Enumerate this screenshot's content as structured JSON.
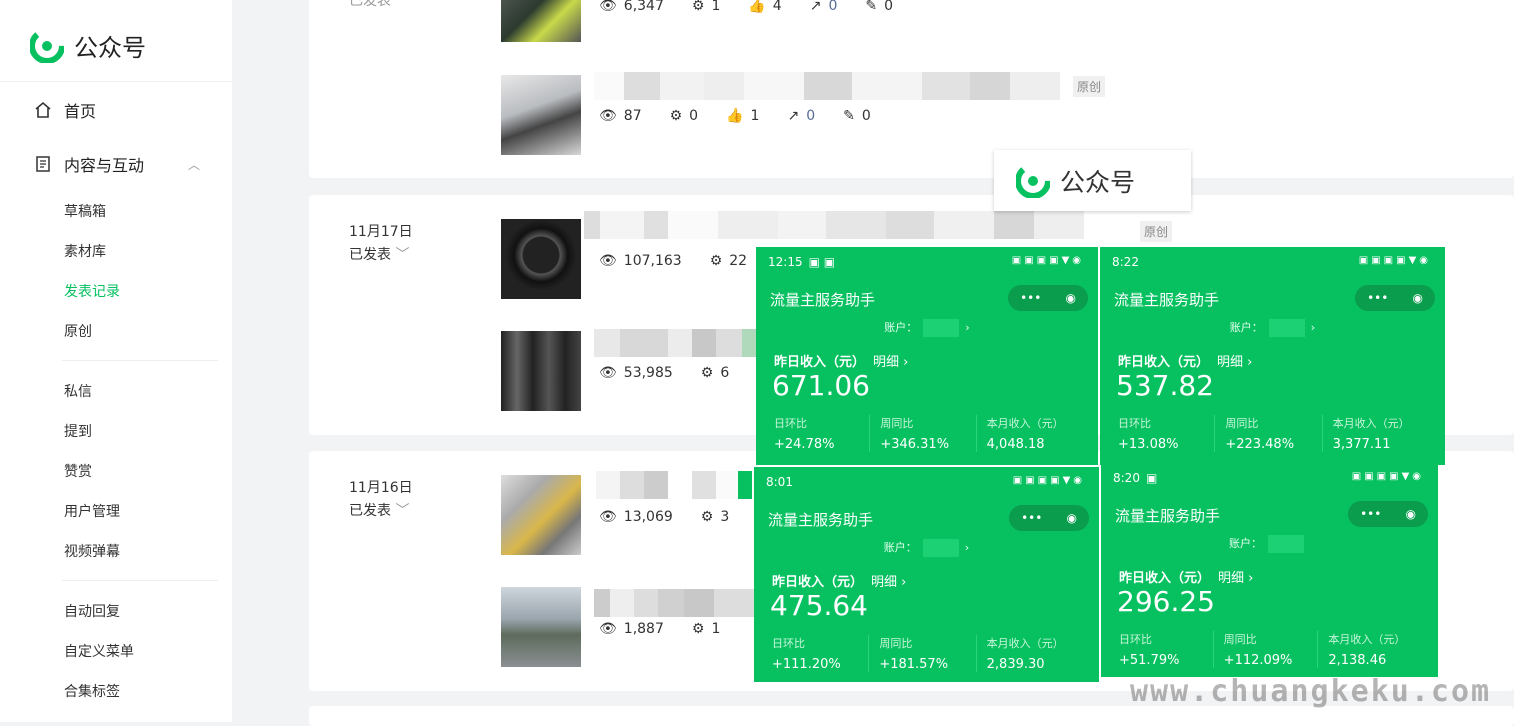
{
  "app": {
    "title": "公众号",
    "brand_color": "#07c160"
  },
  "sidebar": {
    "home": "首页",
    "content_group": "内容与互动",
    "content_items": [
      "草稿箱",
      "素材库",
      "发表记录",
      "原创"
    ],
    "active_item": "发表记录",
    "interaction_items": [
      "私信",
      "提到",
      "赞赏",
      "用户管理",
      "视频弹幕"
    ],
    "settings_items": [
      "自动回复",
      "自定义菜单",
      "合集标签"
    ]
  },
  "posts": {
    "top_status": "已发表",
    "top_row1": {
      "views": "6,347",
      "shares": "1",
      "likes": "4",
      "forwards": "0",
      "comments": "0"
    },
    "top_row2": {
      "views": "87",
      "shares": "0",
      "likes": "1",
      "forwards": "0",
      "comments": "0",
      "tag": "原创"
    },
    "day2": {
      "date": "11月17日",
      "status": "已发表",
      "row1": {
        "views": "107,163",
        "shares": "22",
        "tag": "原创"
      },
      "row2": {
        "views": "53,985",
        "shares": "6"
      }
    },
    "day3": {
      "date": "11月16日",
      "status": "已发表",
      "row1": {
        "views": "13,069",
        "shares": "3"
      },
      "row2": {
        "views": "1,887",
        "shares": "1"
      }
    }
  },
  "watermark": {
    "logo_text": "公众号",
    "site": "www.chuangkeku.com"
  },
  "phones": [
    {
      "time": "12:15",
      "title": "流量主服务助手",
      "account_label": "账户：",
      "income_label": "昨日收入（元）",
      "detail": "明细 ›",
      "income": "671.06",
      "m1_label": "日环比",
      "m1": "+24.78%",
      "m2_label": "周同比",
      "m2": "+346.31%",
      "m3_label": "本月收入（元）",
      "m3": "4,048.18"
    },
    {
      "time": "8:22",
      "title": "流量主服务助手",
      "account_label": "账户：",
      "income_label": "昨日收入（元）",
      "detail": "明细 ›",
      "income": "537.82",
      "m1_label": "日环比",
      "m1": "+13.08%",
      "m2_label": "周同比",
      "m2": "+223.48%",
      "m3_label": "本月收入（元）",
      "m3": "3,377.11"
    },
    {
      "time": "8:01",
      "title": "流量主服务助手",
      "account_label": "账户：",
      "income_label": "昨日收入（元）",
      "detail": "明细 ›",
      "income": "475.64",
      "m1_label": "日环比",
      "m1": "+111.20%",
      "m2_label": "周同比",
      "m2": "+181.57%",
      "m3_label": "本月收入（元）",
      "m3": "2,839.30"
    },
    {
      "time": "8:20",
      "title": "流量主服务助手",
      "account_label": "账户：",
      "income_label": "昨日收入（元）",
      "detail": "明细 ›",
      "income": "296.25",
      "m1_label": "日环比",
      "m1": "+51.79%",
      "m2_label": "周同比",
      "m2": "+112.09%",
      "m3_label": "本月收入（元）",
      "m3": "2,138.46"
    }
  ]
}
